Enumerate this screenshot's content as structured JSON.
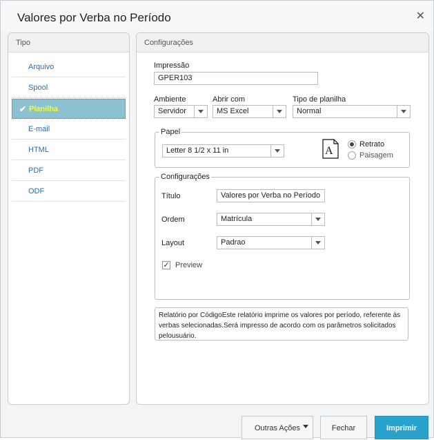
{
  "window": {
    "title": "Valores por Verba no Período"
  },
  "sidebar": {
    "header": "Tipo",
    "items": [
      {
        "label": "Arquivo"
      },
      {
        "label": "Spool"
      },
      {
        "label": "Planilha"
      },
      {
        "label": "E-mail"
      },
      {
        "label": "HTML"
      },
      {
        "label": "PDF"
      },
      {
        "label": "ODF"
      }
    ]
  },
  "config": {
    "header": "Configurações",
    "impressao_label": "Impressão",
    "impressao_value": "GPER103",
    "ambiente_label": "Ambiente",
    "ambiente_value": "Servidor",
    "abrir_label": "Abrir com",
    "abrir_value": "MS Excel",
    "tipo_label": "Tipo de planilha",
    "tipo_value": "Normal",
    "papel": {
      "title": "Papel",
      "size_value": "Letter 8 1/2 x 11 in",
      "icon_letter": "A",
      "retrato": "Retrato",
      "paisagem": "Paisagem"
    },
    "settings": {
      "title": "Configurações",
      "titulo_label": "Título",
      "titulo_value": "Valores por Verba no Período",
      "ordem_label": "Ordem",
      "ordem_value": "Matrícula",
      "layout_label": "Layout",
      "layout_value": "Padrao",
      "preview_label": "Preview"
    },
    "description": "Relatório por CódigoEste relatório imprime os valores por período, referente às verbas selecionadas.Será impresso de acordo com os parâmetros solicitados pelousuário."
  },
  "footer": {
    "outras": "Outras Ações",
    "fechar": "Fechar",
    "imprimir": "Imprimir"
  }
}
